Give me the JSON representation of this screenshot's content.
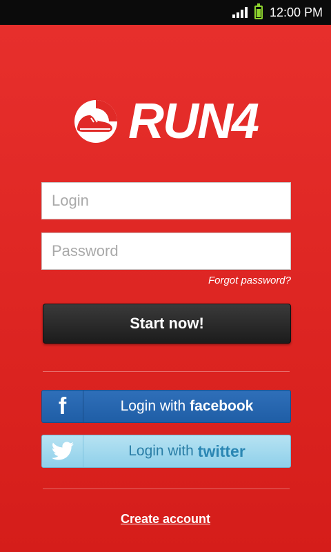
{
  "status_bar": {
    "time": "12:00 PM",
    "signal_icon": "signal-icon",
    "battery_icon": "battery-icon"
  },
  "logo": {
    "text": "RUN4",
    "icon": "shoe-logo-icon"
  },
  "form": {
    "login_placeholder": "Login",
    "login_value": "",
    "password_placeholder": "Password",
    "password_value": "",
    "forgot_label": "Forgot password?",
    "start_label": "Start now!"
  },
  "social": {
    "facebook_prefix": "Login with",
    "facebook_brand": "facebook",
    "facebook_icon": "facebook-icon",
    "twitter_prefix": "Login with",
    "twitter_brand": "twitter",
    "twitter_icon": "twitter-bird-icon"
  },
  "footer": {
    "create_account_label": "Create account"
  },
  "colors": {
    "background": "#e02a27",
    "status_bar": "#0b0b0b",
    "battery": "#8fd62e",
    "start_button": "#262626",
    "facebook": "#2566b0",
    "twitter": "#a3d9ee"
  }
}
